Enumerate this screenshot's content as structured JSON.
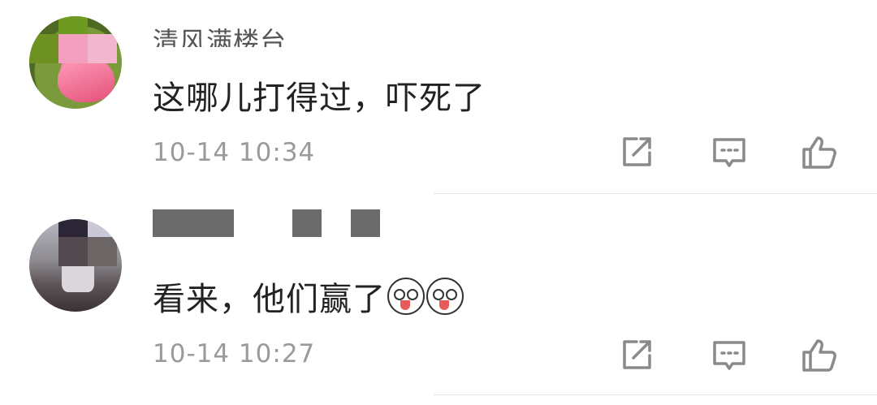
{
  "comments": [
    {
      "name": "清风满楼台",
      "text": "这哪儿打得过，吓死了",
      "time": "10-14 10:34",
      "avatar": "lotus-avatar"
    },
    {
      "name": "",
      "text": "看来，他们赢了",
      "emojis": [
        "husky-emoji",
        "husky-emoji"
      ],
      "time": "10-14 10:27",
      "avatar": "person-avatar"
    }
  ],
  "icons": {
    "share": "share-icon",
    "reply": "comment-icon",
    "like": "thumbs-up-icon"
  },
  "colors": {
    "text": "#222222",
    "meta": "#9a9a9a",
    "icon": "#8a8a8a"
  }
}
